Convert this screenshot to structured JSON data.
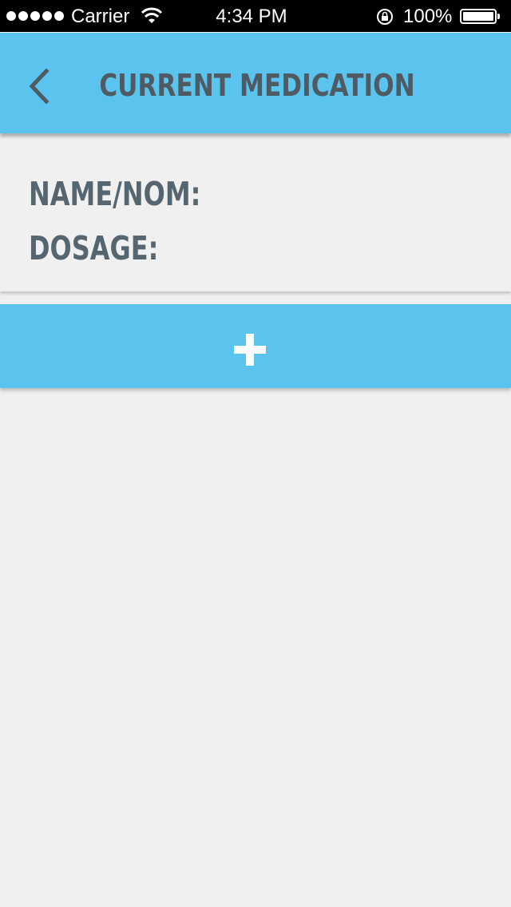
{
  "status_bar": {
    "carrier": "Carrier",
    "time": "4:34 PM",
    "battery": "100%",
    "icons": [
      "signal-dots-icon",
      "wifi-icon",
      "rotation-lock-icon",
      "battery-icon"
    ]
  },
  "header": {
    "title": "CURRENT MEDICATION",
    "back_icon": "chevron-left-icon"
  },
  "medication": {
    "name_label": "NAME/NOM:",
    "dosage_label": "DOSAGE:"
  },
  "add_button": {
    "icon": "plus-icon"
  },
  "colors": {
    "accent": "#5bc4ee",
    "title_text": "#505a62",
    "label_text": "#566671",
    "background": "#efefef"
  }
}
